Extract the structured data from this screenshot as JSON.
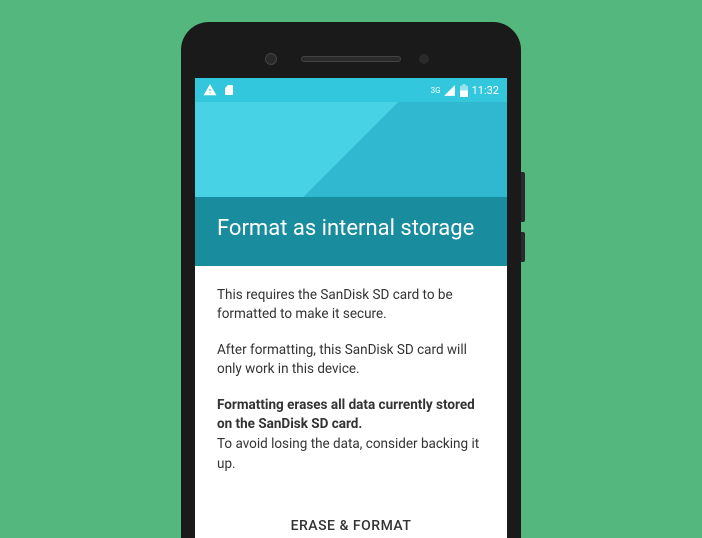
{
  "statusbar": {
    "network_label": "3G",
    "time": "11:32"
  },
  "header": {
    "title": "Format as internal storage"
  },
  "body": {
    "p1": "This requires the SanDisk SD card to be formatted to make it secure.",
    "p2": "After formatting, this SanDisk SD card will only work in this device.",
    "p3_bold": "Formatting erases all data currently stored on the SanDisk SD card.",
    "p3_rest": "To avoid losing the data, consider backing it up."
  },
  "action": {
    "label": "ERASE & FORMAT"
  }
}
